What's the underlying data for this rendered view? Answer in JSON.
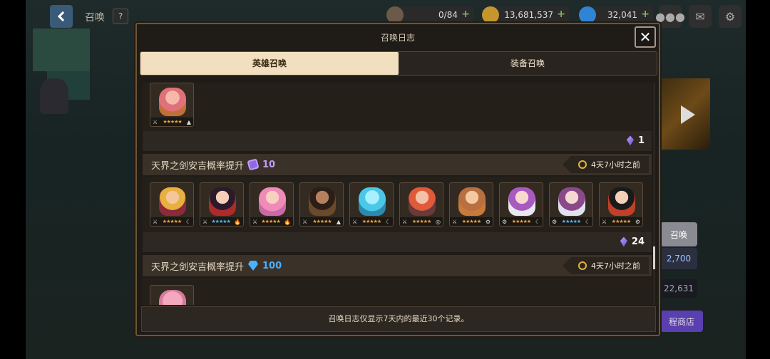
{
  "scene": {
    "title": "召唤",
    "help_label": "?",
    "resources": [
      {
        "name": "stamina",
        "value": "0/84",
        "icon": "mug-icon"
      },
      {
        "name": "gold",
        "value": "13,681,537",
        "icon": "coin-icon"
      },
      {
        "name": "gems",
        "value": "32,041",
        "icon": "diamond-icon"
      }
    ],
    "side_values": {
      "summon_partial": "召唤",
      "price": "2,700",
      "count": "22,631",
      "shop_partial": "程商店"
    }
  },
  "modal": {
    "title": "召唤日志",
    "close_label": "✕",
    "tabs": [
      {
        "label": "英雄召唤",
        "active": true
      },
      {
        "label": "装备召唤",
        "active": false
      }
    ],
    "entries": [
      {
        "heroes": [
          {
            "weapon": "⚔",
            "stars": "★★★★★",
            "elem": "▲"
          }
        ],
        "gained_count": "1"
      },
      {
        "banner": "天界之剑安吉概率提升",
        "cost_type": "ticket",
        "cost": "10",
        "time": "4天7小时之前",
        "heroes": [
          {
            "weapon": "⚔",
            "stars": "★★★★★",
            "elem": "☾"
          },
          {
            "weapon": "⚔",
            "stars": "★★★★★",
            "elem": "🔥"
          },
          {
            "weapon": "⚔",
            "stars": "★★★★★",
            "elem": "🔥"
          },
          {
            "weapon": "⚔",
            "stars": "★★★★★",
            "elem": "▲"
          },
          {
            "weapon": "⚔",
            "stars": "★★★★★",
            "elem": "☾"
          },
          {
            "weapon": "⚔",
            "stars": "★★★★★",
            "elem": "◎"
          },
          {
            "weapon": "⚔",
            "stars": "★★★★★",
            "elem": "⚙"
          },
          {
            "weapon": "⚙",
            "stars": "★★★★★",
            "elem": "☾"
          },
          {
            "weapon": "⚙",
            "stars": "★★★★★",
            "elem": "☾"
          },
          {
            "weapon": "⚔",
            "stars": "★★★★★",
            "elem": "⚙"
          }
        ],
        "gained_count": "24"
      },
      {
        "banner": "天界之剑安吉概率提升",
        "cost_type": "gem",
        "cost": "100",
        "time": "4天7小时之前"
      }
    ],
    "footer_note": "召唤日志仅显示7天内的最近30个记录。"
  },
  "colors": {
    "ticket_purple": "#c49cff",
    "gem_blue": "#4ab0ff",
    "clock_gold": "#e5b43c",
    "tab_active": "#f1dfbf"
  }
}
